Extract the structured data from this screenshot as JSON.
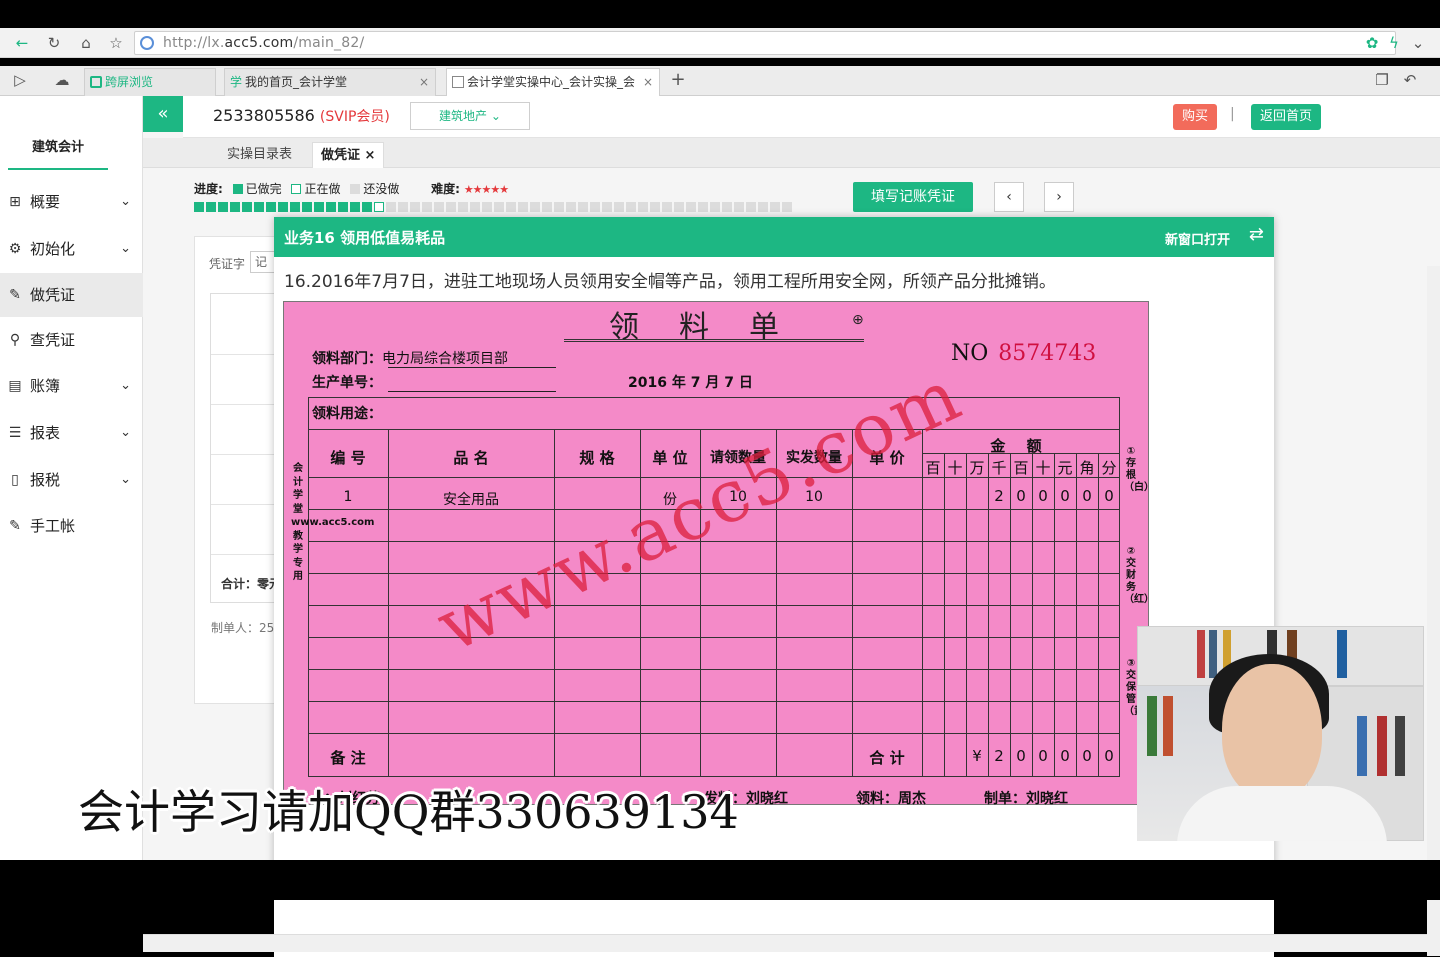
{
  "browser": {
    "url_prefix": "http://lx.",
    "url_domain": "acc5.com",
    "url_path": "/main_82/",
    "tabs": [
      {
        "label": "跨屏浏览"
      },
      {
        "label": "我的首页_会计学堂"
      },
      {
        "label": "会计学堂实操中心_会计实操_会"
      }
    ]
  },
  "sidebar": {
    "brand": "建筑会计",
    "items": [
      {
        "label": "概要",
        "icon": "grid-icon"
      },
      {
        "label": "初始化",
        "icon": "gear-icon"
      },
      {
        "label": "做凭证",
        "icon": "pen-icon"
      },
      {
        "label": "查凭证",
        "icon": "search-icon"
      },
      {
        "label": "账簿",
        "icon": "book-icon"
      },
      {
        "label": "报表",
        "icon": "list-icon"
      },
      {
        "label": "报税",
        "icon": "file-icon"
      },
      {
        "label": "手工帐",
        "icon": "pen-icon"
      }
    ]
  },
  "header": {
    "user_id": "2533805586",
    "membership": "(SVIP会员)",
    "industry": "建筑地产",
    "buy": "购买",
    "separator": "|",
    "home": "返回首页"
  },
  "subtabs": [
    {
      "label": "实操目录表"
    },
    {
      "label": "做凭证 ×"
    }
  ],
  "progress": {
    "label": "进度:",
    "done": "已做完",
    "doing": "正在做",
    "todo": "还没做",
    "difficulty_label": "难度:",
    "stars": "★★★★★",
    "done_count": 16,
    "total_count": 50,
    "colors": {
      "done": "#1db783",
      "doing": "#ffffff",
      "todo": "#dcdcdc"
    }
  },
  "actions": {
    "fill_voucher": "填写记账凭证",
    "prev": "‹",
    "next": "›"
  },
  "bg_form": {
    "voucher_word_label": "凭证字",
    "voucher_word_value": "记",
    "total": "合计：零元",
    "maker": "制单人：25"
  },
  "modal": {
    "title": "业务16 领用低值易耗品",
    "open_new": "新窗口打开",
    "description": "16.2016年7月7日，进驻工地现场人员领用安全帽等产品，领用工程所用安全网，所领产品分批摊销。"
  },
  "voucher": {
    "title": "领料单",
    "no_label": "NO",
    "no_value": "8574743",
    "dept_label": "领料部门：",
    "dept_value": "电力局综合楼项目部",
    "prod_label": "生产单号：",
    "date": "2016 年 7 月 7 日",
    "purpose_label": "领料用途：",
    "headers": [
      "编 号",
      "品 名",
      "规 格",
      "单 位",
      "请领数量",
      "实发数量",
      "单 价"
    ],
    "amount_header": "金 额",
    "digit_headers": [
      "百",
      "十",
      "万",
      "千",
      "百",
      "十",
      "元",
      "角",
      "分"
    ],
    "row": {
      "no": "1",
      "name": "安全用品",
      "unit": "份",
      "req": "10",
      "issued": "10",
      "digits": [
        "",
        "",
        "",
        "2",
        "0",
        "0",
        "0",
        "0",
        "0"
      ]
    },
    "remark_label": "备 注",
    "total_label": "合 计",
    "total_digits": [
      "",
      "",
      "¥",
      "2",
      "0",
      "0",
      "0",
      "0",
      "0"
    ],
    "left_vertical": "会计学堂www.acc5.com教学专用",
    "right_1": "①存根（白）",
    "right_2": "②交财务（红）",
    "right_3": "③交保管（黄）",
    "sig_partial": "：刘红芳",
    "sig_issue": "发料：刘晓红",
    "sig_receive": "领料：周杰",
    "sig_maker": "制单：刘晓红",
    "watermark": "www.acc5.com"
  },
  "overlay": {
    "qq_text": "会计学习请加QQ群330639134"
  }
}
